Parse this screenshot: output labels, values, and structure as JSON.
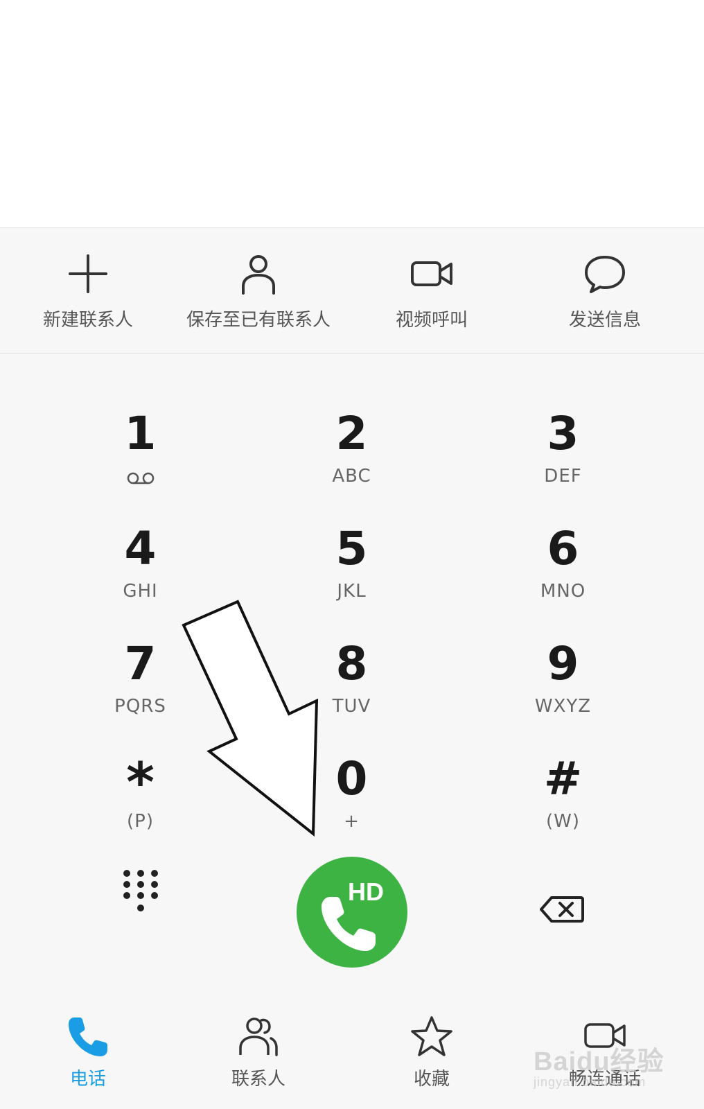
{
  "actions": [
    {
      "icon": "plus-icon",
      "label": "新建联系人"
    },
    {
      "icon": "person-icon",
      "label": "保存至已有联系人"
    },
    {
      "icon": "video-camera-icon",
      "label": "视频呼叫"
    },
    {
      "icon": "chat-bubble-icon",
      "label": "发送信息"
    }
  ],
  "keys": [
    {
      "digit": "1",
      "letters": "",
      "voicemail": true
    },
    {
      "digit": "2",
      "letters": "ABC"
    },
    {
      "digit": "3",
      "letters": "DEF"
    },
    {
      "digit": "4",
      "letters": "GHI"
    },
    {
      "digit": "5",
      "letters": "JKL"
    },
    {
      "digit": "6",
      "letters": "MNO"
    },
    {
      "digit": "7",
      "letters": "PQRS"
    },
    {
      "digit": "8",
      "letters": "TUV"
    },
    {
      "digit": "9",
      "letters": "WXYZ"
    },
    {
      "digit": "*",
      "letters": "(P)"
    },
    {
      "digit": "0",
      "letters": "+"
    },
    {
      "digit": "#",
      "letters": "(W)"
    }
  ],
  "call": {
    "badge": "HD",
    "color": "#3db343"
  },
  "tabs": [
    {
      "icon": "phone-icon",
      "label": "电话",
      "active": true
    },
    {
      "icon": "contacts-icon",
      "label": "联系人",
      "active": false
    },
    {
      "icon": "star-icon",
      "label": "收藏",
      "active": false
    },
    {
      "icon": "video-call-icon",
      "label": "畅连通话",
      "active": false
    }
  ],
  "watermark": {
    "line1": "Baidu经验",
    "line2": "jingyan.baidu.com"
  },
  "colors": {
    "accent": "#1a9de5",
    "call": "#3db343",
    "text": "#1a1a1a"
  }
}
